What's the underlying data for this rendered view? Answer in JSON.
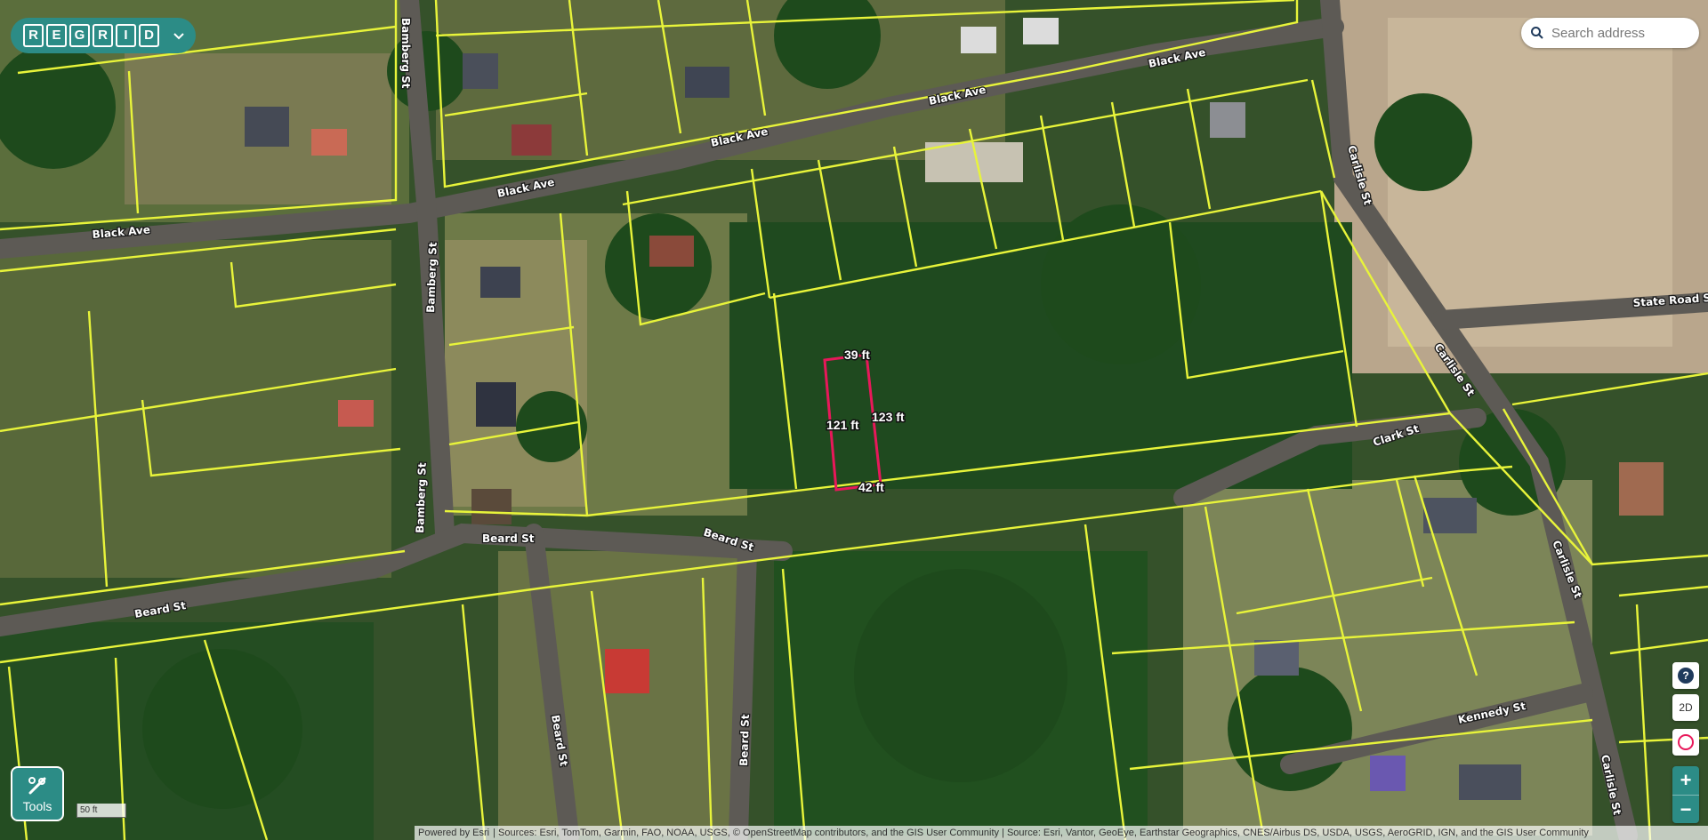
{
  "brand": {
    "letters": [
      "R",
      "E",
      "G",
      "R",
      "I",
      "D"
    ]
  },
  "search": {
    "placeholder": "Search address"
  },
  "streets": {
    "black_ave": "Black Ave",
    "bamberg_st": "Bamberg St",
    "beard_st": "Beard St",
    "carlisle_st": "Carlisle St",
    "clark_st": "Clark St",
    "state_road": "State Road S",
    "kennedy_st": "Kennedy St"
  },
  "selected_parcel": {
    "top": "39 ft",
    "left": "121 ft",
    "right": "123 ft",
    "bottom": "42 ft"
  },
  "controls": {
    "help": "?",
    "view_mode": "2D",
    "zoom_in": "+",
    "zoom_out": "−"
  },
  "tools": {
    "label": "Tools"
  },
  "scale": {
    "label": "50 ft"
  },
  "attribution": {
    "powered_by": "Powered by Esri",
    "sources": "Sources: Esri, TomTom, Garmin, FAO, NOAA, USGS, © OpenStreetMap contributors, and the GIS User Community | Source: Esri, Vantor, GeoEye, Earthstar Geographics, CNES/Airbus DS, USDA, USGS, AeroGRID, IGN, and the GIS User Community"
  },
  "colors": {
    "parcel_line": "#e8f43a",
    "selected_parcel": "#e8185a",
    "brand": "#2c8c86"
  }
}
